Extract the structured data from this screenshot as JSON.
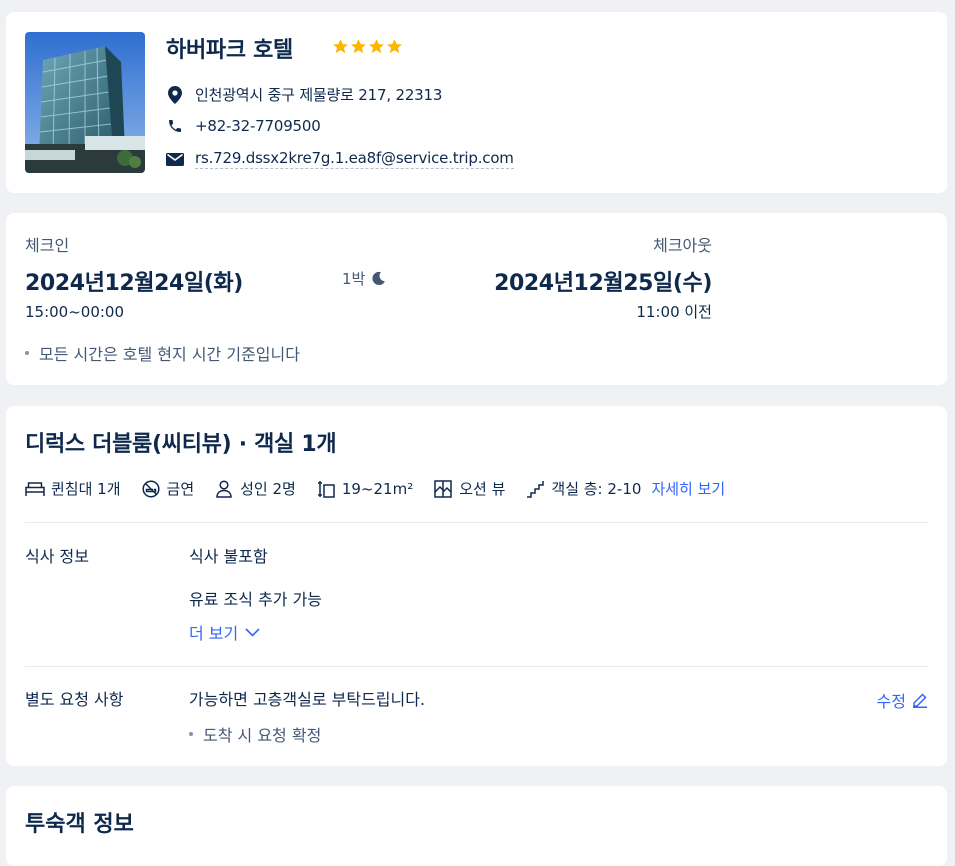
{
  "hotel": {
    "name": "하버파크 호텔",
    "star_count": 4,
    "address": "인천광역시 중구 제물량로 217, 22313",
    "phone": "+82-32-7709500",
    "email": "rs.729.dssx2kre7g.1.ea8f@service.trip.com"
  },
  "stay": {
    "checkin_label": "체크인",
    "checkin_date": "2024년12월24일(화)",
    "checkin_time": "15:00~00:00",
    "nights": "1박",
    "checkout_label": "체크아웃",
    "checkout_date": "2024년12월25일(수)",
    "checkout_time": "11:00 이전",
    "note": "모든 시간은 호텔 현지 시간 기준입니다"
  },
  "room": {
    "title": "디럭스 더블룸(씨티뷰) · 객실 1개",
    "amenities": [
      {
        "icon": "bed-icon",
        "label": "퀸침대 1개"
      },
      {
        "icon": "no-smoking-icon",
        "label": "금연"
      },
      {
        "icon": "person-icon",
        "label": "성인 2명"
      },
      {
        "icon": "room-size-icon",
        "label": "19~21m²"
      },
      {
        "icon": "window-icon",
        "label": "오션 뷰"
      },
      {
        "icon": "stairs-icon",
        "label": "객실 층: 2-10"
      }
    ],
    "details_link": "자세히 보기",
    "meal_label": "식사 정보",
    "meal_value": "식사 불포함",
    "meal_extra": "유료 조식 추가 가능",
    "more_link": "더 보기",
    "request_label": "별도 요청 사항",
    "request_value": "가능하면 고층객실로 부탁드립니다.",
    "request_note": "도착 시 요청 확정",
    "edit_link": "수정"
  },
  "guest": {
    "title": "투숙객 정보"
  },
  "colors": {
    "text": "#0f294d",
    "secondary": "#455873",
    "link": "#3264ff",
    "star": "#ffb400",
    "background": "#eff1f5"
  }
}
